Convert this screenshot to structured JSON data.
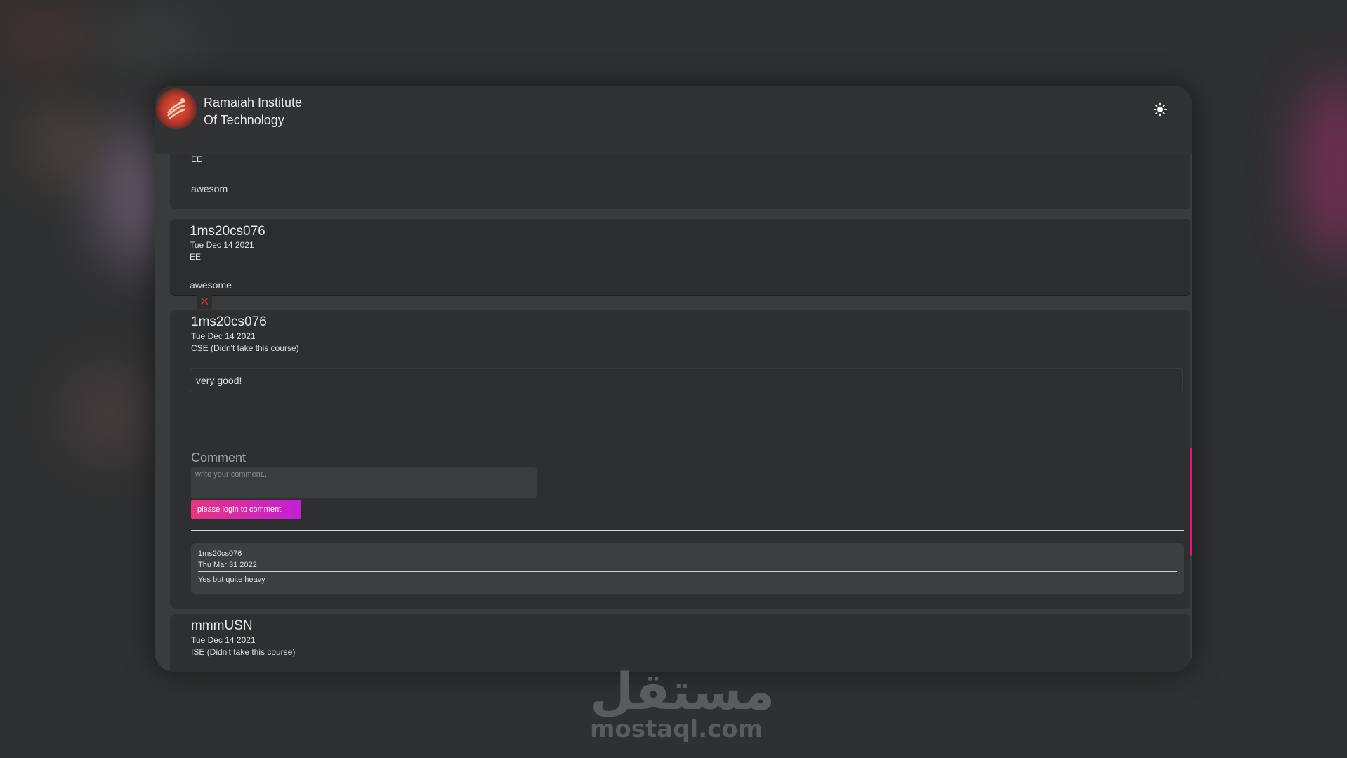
{
  "header": {
    "brand_line1": "Ramaiah Institute",
    "brand_line2": "Of Technology",
    "theme_icon": "sun-icon"
  },
  "reviews": [
    {
      "dept": "EE",
      "body": "awesom"
    },
    {
      "user": "1ms20cs076",
      "date": "Tue Dec 14 2021",
      "dept": "EE",
      "body": "awesome"
    },
    {
      "user": "1ms20cs076",
      "date": "Tue Dec 14 2021",
      "dept": "CSE (Didn't take this course)",
      "body": "very good!",
      "comment_label": "Comment",
      "comment_placeholder": "write your comment...",
      "login_button": "please login to comment",
      "replies": [
        {
          "user": "1ms20cs076",
          "date": "Thu Mar 31 2022",
          "text": "Yes but quite heavy"
        }
      ]
    },
    {
      "user": "mmmUSN",
      "date": "Tue Dec 14 2021",
      "dept": "ISE (Didn't take this course)"
    }
  ],
  "watermark": {
    "arabic": "مستقل",
    "latin": "mostaql.com"
  },
  "colors": {
    "accent_pink": "#e3187f",
    "button_gradient_start": "#e9347f",
    "button_gradient_end": "#c21fd8"
  }
}
